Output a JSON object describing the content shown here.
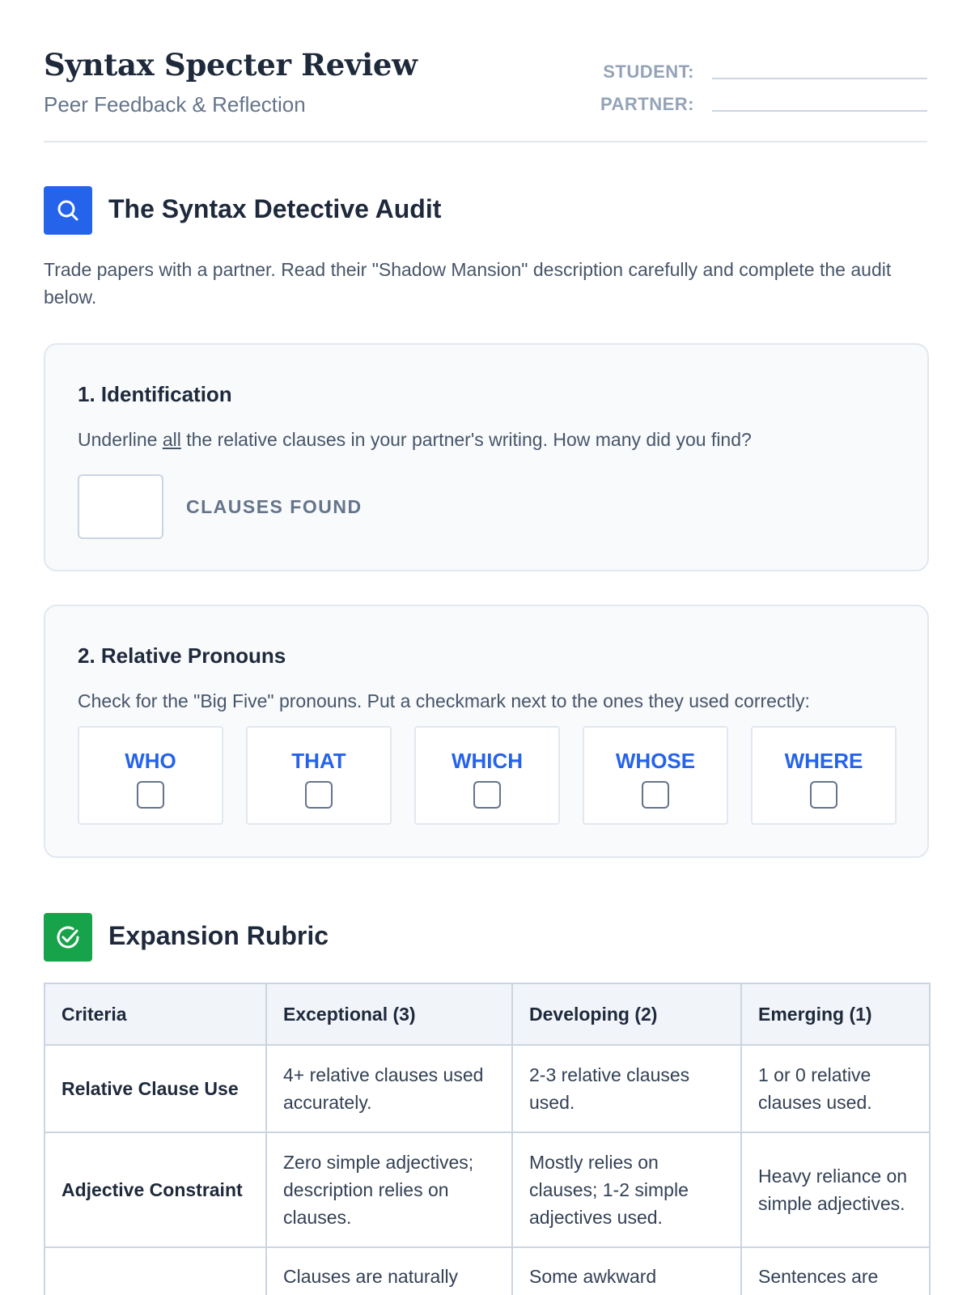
{
  "header": {
    "title": "Syntax Specter Review",
    "subtitle": "Peer Feedback & Reflection",
    "student_label": "STUDENT:",
    "partner_label": "PARTNER:"
  },
  "audit": {
    "title": "The Syntax Detective Audit",
    "icon": "search-icon",
    "intro": "Trade papers with a partner. Read their \"Shadow Mansion\" description carefully and complete the audit below."
  },
  "identification": {
    "title": "1. Identification",
    "text_before": "Underline ",
    "text_emphasis": "all",
    "text_after": " the relative clauses in your partner's writing. How many did you find?",
    "count_label": "CLAUSES FOUND"
  },
  "pronouns": {
    "title": "2. Relative Pronouns",
    "text": "Check for the \"Big Five\" pronouns. Put a checkmark next to the ones they used correctly:",
    "items": [
      "WHO",
      "THAT",
      "WHICH",
      "WHOSE",
      "WHERE"
    ]
  },
  "rubric": {
    "title": "Expansion Rubric",
    "icon": "check-circle-icon",
    "headers": [
      "Criteria",
      "Exceptional (3)",
      "Developing (2)",
      "Emerging (1)"
    ],
    "rows": [
      [
        "Relative Clause Use",
        "4+ relative clauses used accurately.",
        "2-3 relative clauses used.",
        "1 or 0 relative clauses used."
      ],
      [
        "Adjective Constraint",
        "Zero simple adjectives; description relies on clauses.",
        "Mostly relies on clauses; 1-2 simple adjectives used.",
        "Heavy reliance on simple adjectives."
      ],
      [
        "",
        "Clauses are naturally",
        "Some awkward",
        "Sentences are"
      ]
    ]
  },
  "colors": {
    "accent_blue": "#2563eb",
    "accent_green": "#16a34a"
  }
}
